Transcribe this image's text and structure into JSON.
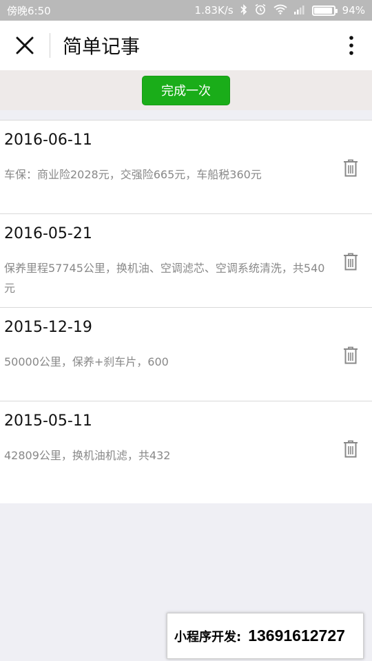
{
  "status_bar": {
    "time": "傍晚6:50",
    "network_speed": "1.83K/s",
    "battery_percent": "94%",
    "battery_level": 0.94,
    "icons": [
      "bluetooth-icon",
      "alarm-icon",
      "wifi-icon",
      "signal-icon",
      "battery-icon"
    ]
  },
  "nav": {
    "title": "简单记事",
    "close_icon": "close-icon",
    "more_icon": "more-vertical-icon"
  },
  "actions": {
    "complete_label": "完成一次",
    "accent_color": "#1aad19"
  },
  "records": [
    {
      "date": "2016-06-11",
      "text": "车保：商业险2028元，交强险665元，车船税360元"
    },
    {
      "date": "2016-05-21",
      "text": "保养里程57745公里，换机油、空调滤芯、空调系统清洗，共540元"
    },
    {
      "date": "2015-12-19",
      "text": "50000公里，保养+刹车片，600"
    },
    {
      "date": "2015-05-11",
      "text": "42809公里，换机油机滤，共432"
    }
  ],
  "watermark": {
    "label": "小程序开发:",
    "phone": "13691612727"
  }
}
